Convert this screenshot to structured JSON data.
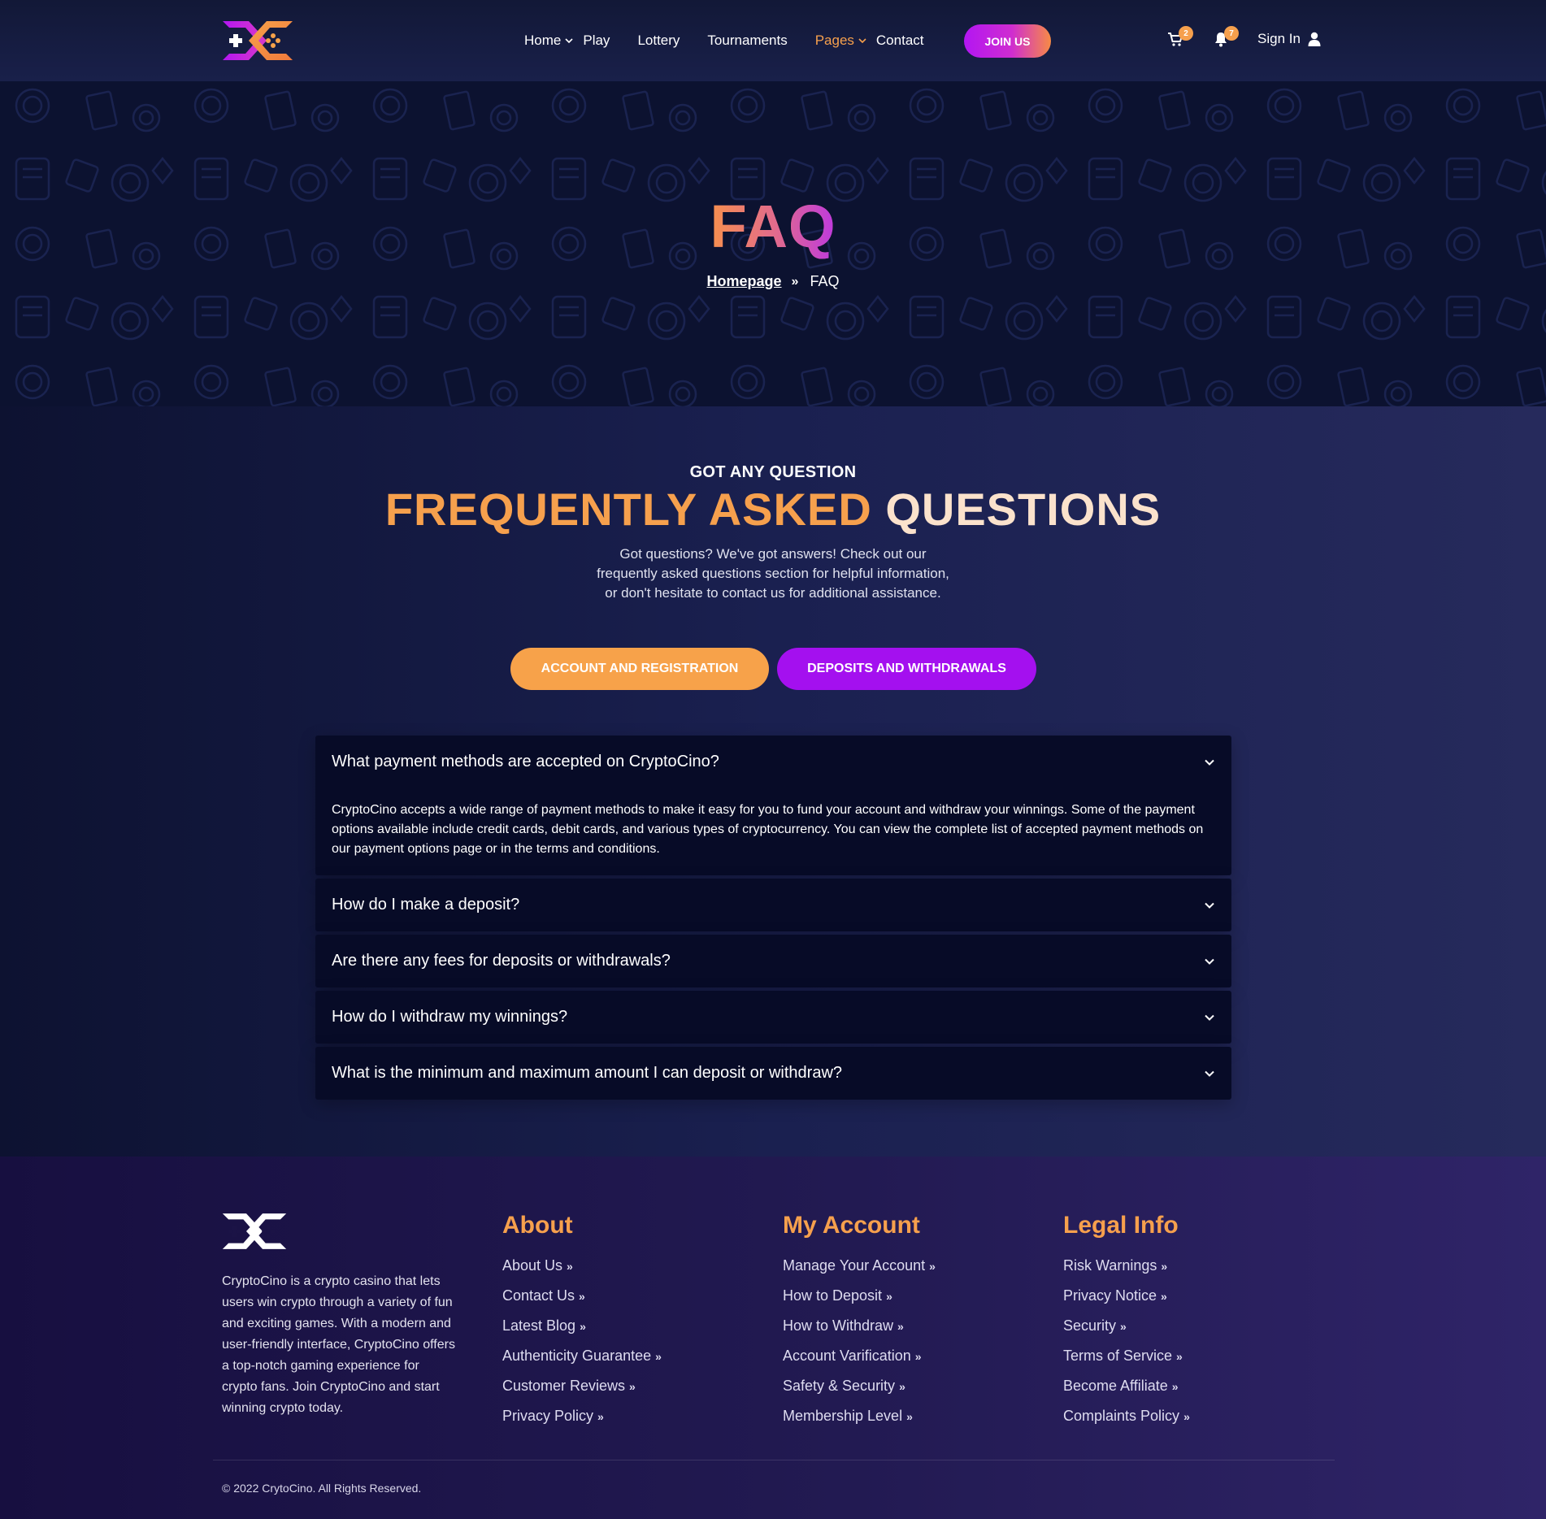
{
  "header": {
    "nav": [
      {
        "label": "Home",
        "has_dropdown": true,
        "active": false
      },
      {
        "label": "Play",
        "has_dropdown": false,
        "active": false
      },
      {
        "label": "Lottery",
        "has_dropdown": false,
        "active": false
      },
      {
        "label": "Tournaments",
        "has_dropdown": false,
        "active": false
      },
      {
        "label": "Pages",
        "has_dropdown": true,
        "active": true
      },
      {
        "label": "Contact",
        "has_dropdown": false,
        "active": false
      }
    ],
    "join_label": "JOIN US",
    "cart_count": "2",
    "notification_count": "7",
    "signin_label": "Sign In"
  },
  "hero": {
    "title": "FAQ",
    "breadcrumb_home": "Homepage",
    "breadcrumb_current": "FAQ"
  },
  "faq": {
    "eyebrow": "GOT ANY QUESTION",
    "title_part1": "FREQUENTLY ASKED",
    "title_part2": "QUESTIONS",
    "description_lines": [
      "Got questions? We've got answers! Check out our",
      "frequently asked questions section for helpful information,",
      "or don't hesitate to contact us for additional assistance."
    ],
    "tabs": [
      {
        "label": "ACCOUNT AND REGISTRATION",
        "selected": false
      },
      {
        "label": "DEPOSITS AND WITHDRAWALS",
        "selected": true
      }
    ],
    "items": [
      {
        "question": "What payment methods are accepted on CryptoCino?",
        "expanded": true,
        "answer": "CryptoCino accepts a wide range of payment methods to make it easy for you to fund your account and withdraw your winnings. Some of the payment options available include credit cards, debit cards, and various types of cryptocurrency. You can view the complete list of accepted payment methods on our payment options page or in the terms and conditions."
      },
      {
        "question": "How do I make a deposit?",
        "expanded": false
      },
      {
        "question": "Are there any fees for deposits or withdrawals?",
        "expanded": false
      },
      {
        "question": "How do I withdraw my winnings?",
        "expanded": false
      },
      {
        "question": "What is the minimum and maximum amount I can deposit or withdraw?",
        "expanded": false
      }
    ]
  },
  "footer": {
    "about_text": "CryptoCino is a crypto casino that lets users win crypto through a variety of fun and exciting games. With a modern and user-friendly interface, CryptoCino offers a top-notch gaming experience for crypto fans. Join CryptoCino and start winning crypto today.",
    "columns": [
      {
        "title": "About",
        "links": [
          "About Us",
          "Contact Us",
          "Latest Blog",
          "Authenticity Guarantee",
          "Customer Reviews",
          "Privacy Policy"
        ]
      },
      {
        "title": "My Account",
        "links": [
          "Manage Your Account",
          "How to Deposit",
          "How to Withdraw",
          "Account Varification",
          "Safety & Security",
          "Membership Level"
        ]
      },
      {
        "title": "Legal Info",
        "links": [
          "Risk Warnings",
          "Privacy Notice",
          "Security",
          "Terms of Service",
          "Become Affiliate",
          "Complaints Policy"
        ]
      }
    ],
    "copyright": "© 2022 CrytoCino. All Rights Reserved."
  },
  "colors": {
    "accent_orange": "#f6a04d",
    "accent_purple": "#a410ef",
    "header_bg": "#121837",
    "accordion_bg": "#070b27"
  },
  "icons": [
    "logo",
    "chevron-down-icon",
    "cart-icon",
    "bell-icon",
    "user-icon",
    "double-chevron-right-icon"
  ]
}
